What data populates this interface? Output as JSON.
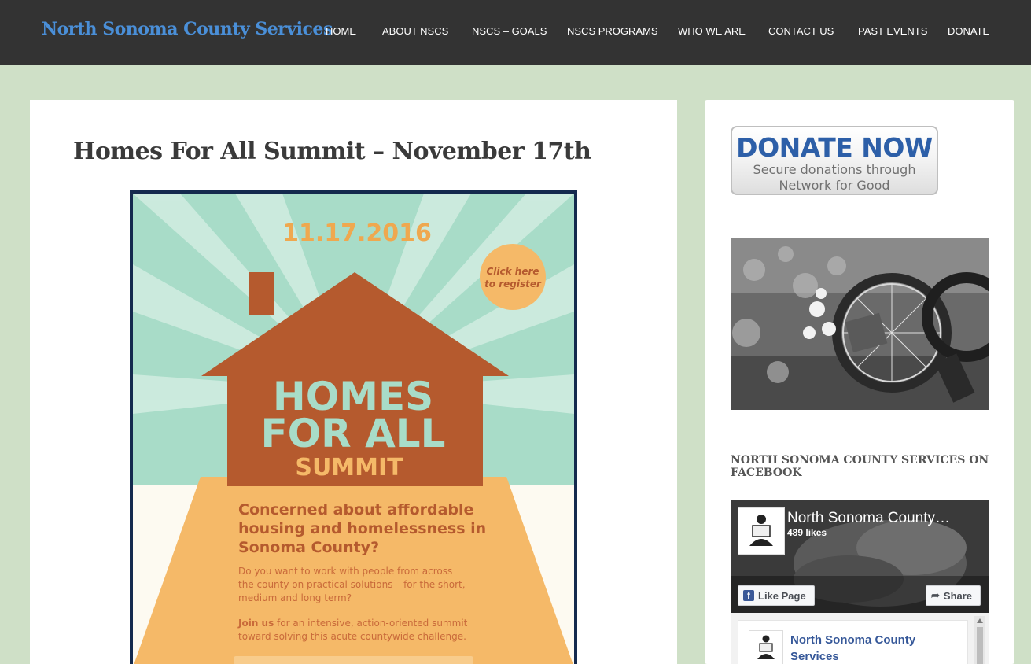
{
  "header": {
    "site_title": "North Sonoma County Services",
    "nav": [
      "HOME",
      "ABOUT NSCS",
      "NSCS – GOALS",
      "NSCS PROGRAMS",
      "WHO WE ARE",
      "CONTACT US",
      "PAST EVENTS",
      "DONATE"
    ]
  },
  "post": {
    "title": "Homes For All Summit – November 17th",
    "poster": {
      "date": "11.17.2016",
      "register_line1": "Click here",
      "register_line2": "to register",
      "headline_line1": "HOMES",
      "headline_line2": "FOR ALL",
      "headline_line3": "SUMMIT",
      "question_line1": "Concerned about affordable",
      "question_line2": "housing and homelessness in",
      "question_line3": "Sonoma County?",
      "body_line1": "Do you want to work with people from across",
      "body_line2": "the county on practical solutions – for the short,",
      "body_line3": "medium and long term?",
      "join_bold": "Join us",
      "join_rest": " for an intensive, action-oriented summit",
      "join_line2": "toward solving this acute countywide challenge."
    }
  },
  "sidebar": {
    "donate": {
      "main": "DONATE NOW",
      "sub_line1": "Secure donations through",
      "sub_line2": "Network for Good"
    },
    "facebook_widget": {
      "title": "NORTH SONOMA COUNTY SERVICES ON FACEBOOK",
      "page_name": "North Sonoma County…",
      "likes": "489 likes",
      "like_button": "Like Page",
      "share_button": "Share",
      "feed_name_line1": "North Sonoma County",
      "feed_name_line2": "Services"
    }
  },
  "colors": {
    "page_background": "#cfe0c7",
    "header_background": "#333333",
    "site_title": "#4a8fd8",
    "donate_blue": "#2d5fa8",
    "poster_house": "#b55a2e",
    "poster_mint": "#a8dcc8",
    "poster_orange": "#f5b968",
    "facebook_blue": "#3b5998"
  }
}
